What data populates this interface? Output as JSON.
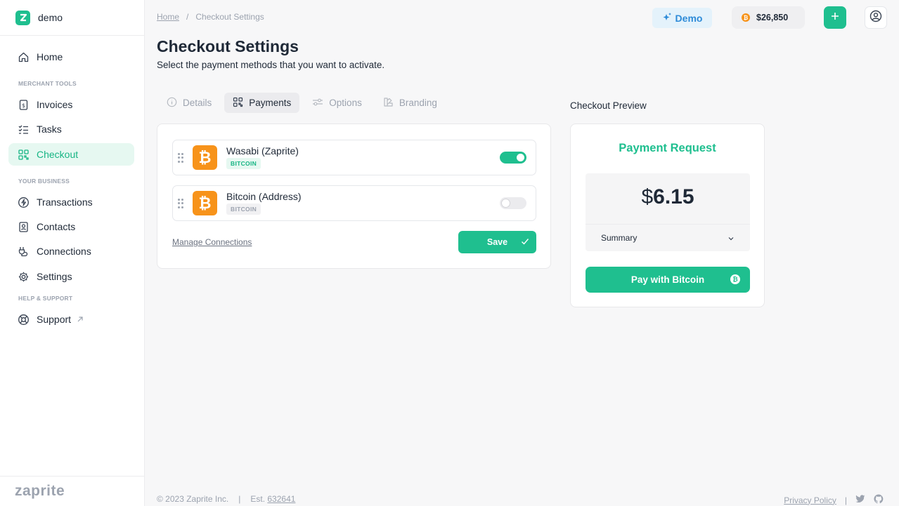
{
  "org": {
    "name": "demo"
  },
  "sidebar": {
    "items": [
      {
        "label": "Home",
        "icon": "home-icon"
      },
      {
        "label": "Invoices",
        "icon": "invoice-icon"
      },
      {
        "label": "Tasks",
        "icon": "tasks-icon"
      },
      {
        "label": "Checkout",
        "icon": "qr-icon",
        "active": true
      },
      {
        "label": "Transactions",
        "icon": "lightning-icon"
      },
      {
        "label": "Contacts",
        "icon": "contacts-icon"
      },
      {
        "label": "Connections",
        "icon": "plug-icon"
      },
      {
        "label": "Settings",
        "icon": "gear-icon"
      },
      {
        "label": "Support",
        "icon": "lifebuoy-icon"
      }
    ],
    "sections": {
      "merchant_tools": "MERCHANT TOOLS",
      "your_business": "YOUR BUSINESS",
      "help_support": "HELP & SUPPORT"
    },
    "brand": "zaprite"
  },
  "breadcrumb": {
    "home": "Home",
    "separator": "/",
    "current": "Checkout Settings"
  },
  "topbar": {
    "demo_label": "Demo",
    "btc_price": "$26,850"
  },
  "page": {
    "title": "Checkout Settings",
    "subtitle": "Select the payment methods that you want to activate."
  },
  "tabs": [
    {
      "label": "Details",
      "icon": "info-icon"
    },
    {
      "label": "Payments",
      "icon": "qr-icon",
      "active": true
    },
    {
      "label": "Options",
      "icon": "sliders-icon"
    },
    {
      "label": "Branding",
      "icon": "palette-icon"
    }
  ],
  "methods": [
    {
      "name": "Wasabi (Zaprite)",
      "tag": "BITCOIN",
      "enabled": true
    },
    {
      "name": "Bitcoin (Address)",
      "tag": "BITCOIN",
      "enabled": false
    }
  ],
  "actions": {
    "manage": "Manage Connections",
    "save": "Save"
  },
  "preview": {
    "label": "Checkout Preview",
    "title": "Payment Request",
    "currency": "$",
    "amount": "6.15",
    "summary": "Summary",
    "pay_button": "Pay with Bitcoin"
  },
  "footer": {
    "copyright": "© 2023 Zaprite Inc.",
    "divider": "|",
    "est_label": "Est.",
    "block": "632641",
    "privacy": "Privacy Policy"
  },
  "colors": {
    "accent": "#1fbf8f",
    "bitcoin": "#f7931a",
    "demo": "#2e8bd8"
  }
}
